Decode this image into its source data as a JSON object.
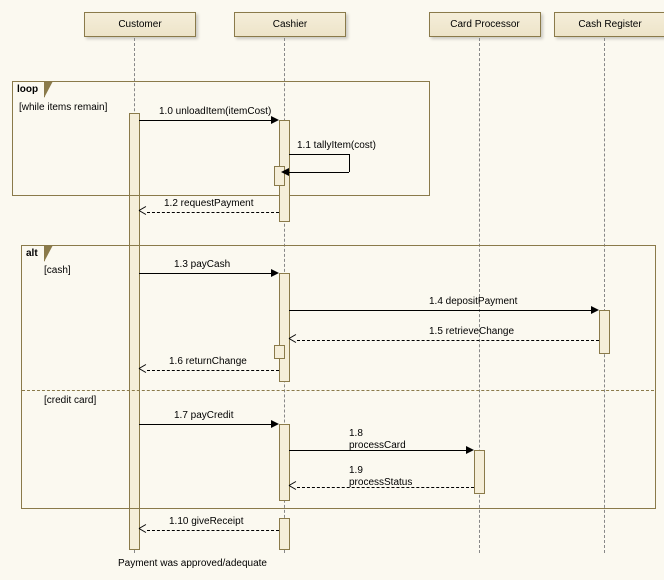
{
  "lifelines": {
    "customer": "Customer",
    "cashier": "Cashier",
    "card_processor": "Card Processor",
    "cash_register": "Cash Register"
  },
  "fragments": {
    "loop": {
      "label": "loop",
      "guard": "[while items remain]"
    },
    "alt": {
      "label": "alt",
      "guard1": "[cash]",
      "guard2": "[credit card]"
    }
  },
  "messages": {
    "m1": "1.0 unloadItem(itemCost)",
    "m2": "1.1 tallyItem(cost)",
    "m3": "1.2 requestPayment",
    "m4": "1.3 payCash",
    "m5": "1.4 depositPayment",
    "m6": "1.5 retrieveChange",
    "m7": "1.6 returnChange",
    "m8": "1.7 payCredit",
    "m9_num": "1.8",
    "m9_name": "processCard",
    "m10_num": "1.9",
    "m10_name": "processStatus",
    "m11": "1.10 giveReceipt"
  },
  "note": "Payment was approved/adequate"
}
